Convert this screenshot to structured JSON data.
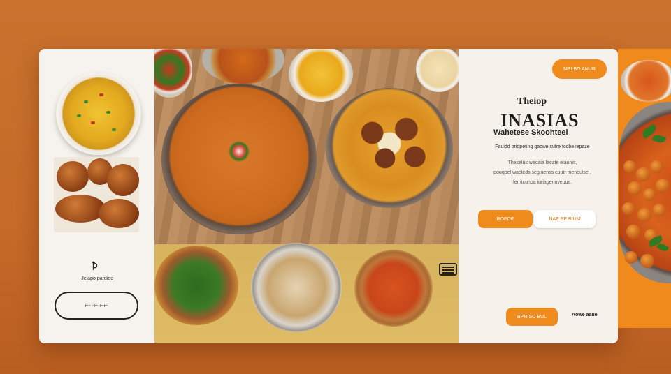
{
  "sidebar": {
    "mini_logo": "ꝥ",
    "mini_text": "Jelapo pardiec",
    "outline_button": "⊢◦ ◦⊢ ⊢⊢"
  },
  "info": {
    "top_button": "MELBO ANUR",
    "brand_small": "Theiop",
    "brand_title": "INASIAS",
    "brand_subtitle": "Wahetese Skoohteel",
    "line_1": "Fauidd pridpeting gacwe sufre tcdbe iepaze",
    "desc_1": "Thaselus wecaia lacate eiaonis,",
    "desc_2": "pouqbel wacteds segiuenss cuutr meneulse ,",
    "desc_3": "fer itcunoa iuriagenoveuus.",
    "btn_primary": "ROPDE",
    "btn_secondary": "NAE BE BIUM",
    "bottom_button": "BPRISO BUL",
    "bottom_label": "Aowe aaue"
  },
  "colors": {
    "accent": "#ef8a1c",
    "background": "#c56a28",
    "panel": "#f6f1ea"
  },
  "icons": {
    "menu": "hamburger-icon",
    "logo": "brand-mark-icon"
  }
}
